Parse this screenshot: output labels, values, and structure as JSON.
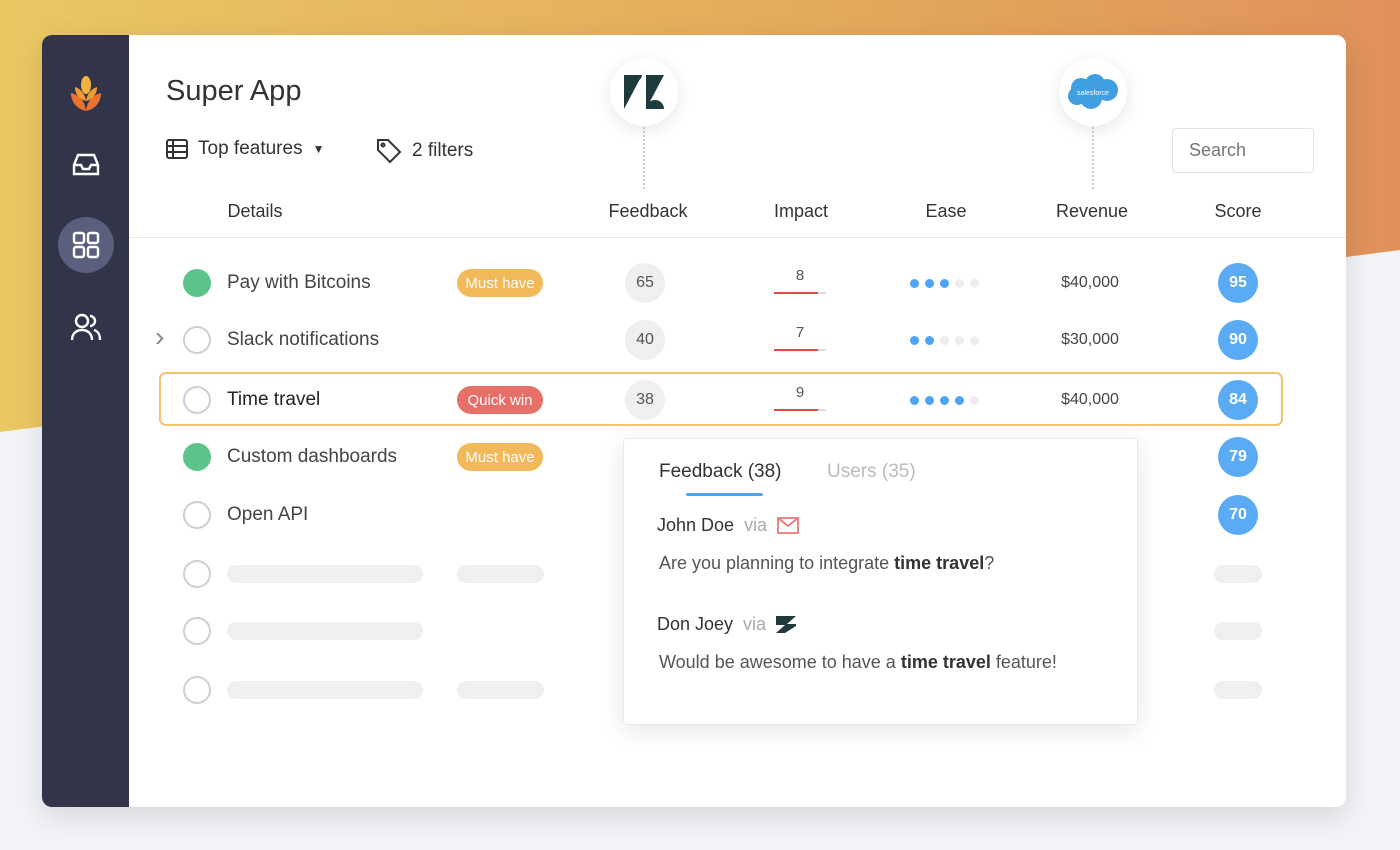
{
  "app": {
    "title": "Super App"
  },
  "toolbar": {
    "view_label": "Top features",
    "filters_label": "2 filters",
    "search_placeholder": "Search"
  },
  "sidebar": {
    "items": [
      {
        "icon": "inbox-icon"
      },
      {
        "icon": "grid-icon",
        "active": true
      },
      {
        "icon": "users-icon"
      }
    ]
  },
  "integrations": [
    {
      "name": "zendesk",
      "column": "Feedback"
    },
    {
      "name": "salesforce",
      "column": "Revenue",
      "logo_text": "salesforce"
    }
  ],
  "columns": [
    "Details",
    "Feedback",
    "Impact",
    "Ease",
    "Revenue",
    "Score"
  ],
  "colors": {
    "must_have": "#f2b95a",
    "quick_win": "#e66f68",
    "done": "#5cc48a",
    "score": "#5aabf4",
    "ease": "#4da3f5",
    "impact": "#e04a3c",
    "highlight": "#f2c46d"
  },
  "rows": [
    {
      "name": "Pay with Bitcoins",
      "done": true,
      "tag": "Must have",
      "tag_type": "must_have",
      "feedback": "65",
      "impact": "8",
      "impact_fill": 0.85,
      "ease": 3,
      "revenue": "$40,000",
      "score": "95"
    },
    {
      "name": "Slack notifications",
      "done": false,
      "expandable": true,
      "feedback": "40",
      "impact": "7",
      "impact_fill": 0.85,
      "ease": 2,
      "revenue": "$30,000",
      "score": "90"
    },
    {
      "name": "Time travel",
      "done": false,
      "selected": true,
      "tag": "Quick win",
      "tag_type": "quick_win",
      "feedback": "38",
      "impact": "9",
      "impact_fill": 0.85,
      "ease": 4,
      "revenue": "$40,000",
      "score": "84"
    },
    {
      "name": "Custom dashboards",
      "done": true,
      "tag": "Must have",
      "tag_type": "must_have",
      "score": "79"
    },
    {
      "name": "Open API",
      "done": false,
      "score": "70"
    },
    {
      "placeholder": true,
      "tag_placeholder": true
    },
    {
      "placeholder": true,
      "tag_placeholder": false
    },
    {
      "placeholder": true,
      "tag_placeholder": true
    }
  ],
  "popover": {
    "tabs": [
      {
        "label": "Feedback (38)",
        "active": true
      },
      {
        "label": "Users (35)",
        "active": false
      }
    ],
    "via": "via",
    "items": [
      {
        "author": "John Doe",
        "source": "email",
        "pre": "Are you planning to integrate ",
        "bold": "time travel",
        "post": "?"
      },
      {
        "author": "Don Joey",
        "source": "zendesk",
        "pre": "Would be awesome to have a ",
        "bold": "time travel",
        "post": " feature!"
      }
    ]
  }
}
